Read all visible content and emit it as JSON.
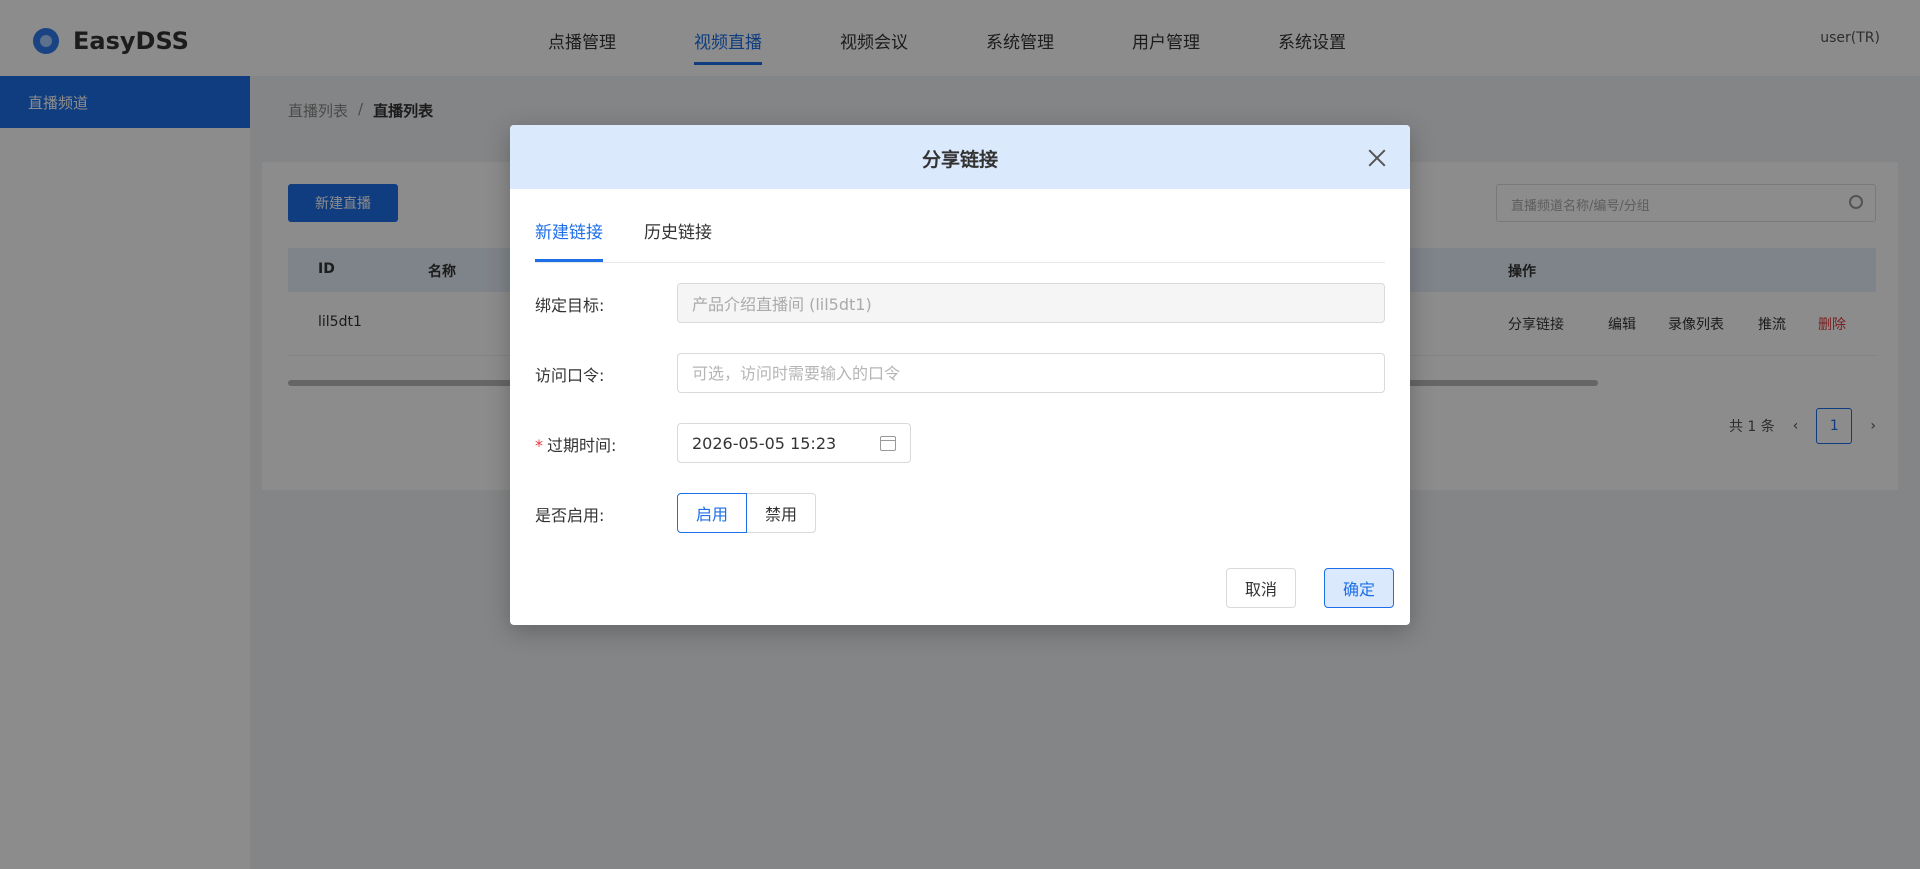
{
  "app": {
    "logo_text": "EasyDSS",
    "nav": [
      "点播管理",
      "视频直播",
      "视频会议",
      "系统管理",
      "用户管理",
      "系统设置"
    ],
    "active_nav_index": 1,
    "user": "user(TR)"
  },
  "sidebar": {
    "items": [
      {
        "label": "直播频道"
      }
    ]
  },
  "breadcrumb": {
    "parent": "直播列表",
    "current": "直播列表"
  },
  "toolbar": {
    "new_label": "新建直播",
    "search_placeholder": "直播频道名称/编号/分组"
  },
  "table": {
    "headers": [
      "ID",
      "名称",
      "操作"
    ],
    "row": {
      "id": "lil5dt1",
      "ops": [
        "分享链接",
        "编辑",
        "录像列表",
        "推流",
        "删除"
      ]
    }
  },
  "pager": {
    "total": "共 1 条",
    "current_page": "1"
  },
  "dialog": {
    "title": "分享链接",
    "tabs": [
      {
        "label": "新建链接",
        "active": true
      },
      {
        "label": "历史链接",
        "active": false
      }
    ],
    "form": {
      "target_label": "绑定目标:",
      "target_value": "产品介绍直播间 (lil5dt1)",
      "password_label": "访问口令:",
      "password_placeholder": "可选，访问时需要输入的口令",
      "expire_required": "*",
      "expire_label": "过期时间:",
      "expire_value": "2026-05-05 15:23",
      "enabled_label": "是否启用:",
      "enabled_options": [
        "启用",
        "禁用"
      ],
      "enabled_selected": "启用"
    },
    "buttons": {
      "cancel": "取消",
      "ok": "确定"
    }
  },
  "colors": {
    "accent": "#1d6fe8",
    "header_bg": "#dbe9fd",
    "required": "#e23a3a"
  }
}
